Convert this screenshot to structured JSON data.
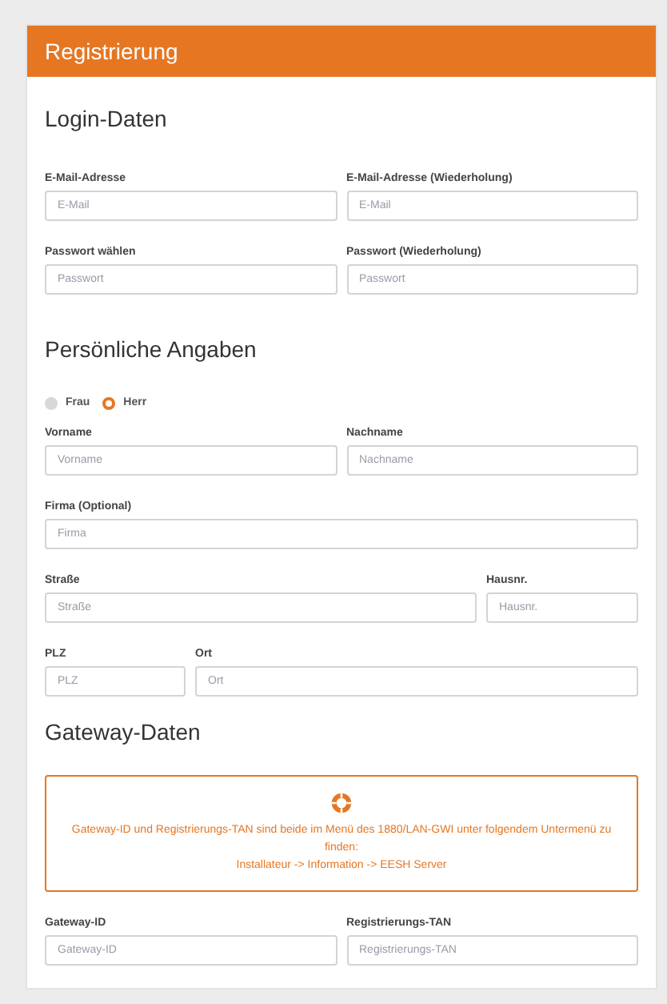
{
  "header": {
    "title": "Registrierung"
  },
  "sections": [
    {
      "title": "Login-Daten",
      "rows": [
        {
          "kind": "half",
          "fields": [
            {
              "label": "E-Mail-Adresse",
              "placeholder": "E-Mail"
            },
            {
              "label": "E-Mail-Adresse (Wiederholung)",
              "placeholder": "E-Mail"
            }
          ]
        },
        {
          "kind": "half",
          "fields": [
            {
              "label": "Passwort wählen",
              "placeholder": "Passwort"
            },
            {
              "label": "Passwort (Wiederholung)",
              "placeholder": "Passwort"
            }
          ]
        }
      ]
    },
    {
      "title": "Persönliche Angaben",
      "salutation": [
        {
          "label": "Frau",
          "selected": false
        },
        {
          "label": "Herr",
          "selected": true
        }
      ],
      "rows": [
        {
          "kind": "half",
          "fields": [
            {
              "label": "Vorname",
              "placeholder": "Vorname"
            },
            {
              "label": "Nachname",
              "placeholder": "Nachname"
            }
          ]
        },
        {
          "kind": "full",
          "fields": [
            {
              "label": "Firma (Optional)",
              "placeholder": "Firma"
            }
          ]
        },
        {
          "kind": "wide",
          "fields": [
            {
              "label": "Straße",
              "placeholder": "Straße"
            },
            {
              "label": "Hausnr.",
              "placeholder": "Hausnr."
            }
          ]
        },
        {
          "kind": "narrow",
          "fields": [
            {
              "label": "PLZ",
              "placeholder": "PLZ"
            },
            {
              "label": "Ort",
              "placeholder": "Ort"
            }
          ]
        }
      ]
    },
    {
      "title": "Gateway-Daten",
      "notice": {
        "lines": [
          "Gateway-ID und Registrierungs-TAN sind beide im Menü des 1880/LAN-GWI unter folgendem Untermenü zu finden:",
          "Installateur -> Information -> EESH Server"
        ]
      },
      "rows": [
        {
          "kind": "half",
          "fields": [
            {
              "label": "Gateway-ID",
              "placeholder": "Gateway-ID"
            },
            {
              "label": "Registrierungs-TAN",
              "placeholder": "Registrierungs-TAN"
            }
          ]
        }
      ]
    }
  ]
}
